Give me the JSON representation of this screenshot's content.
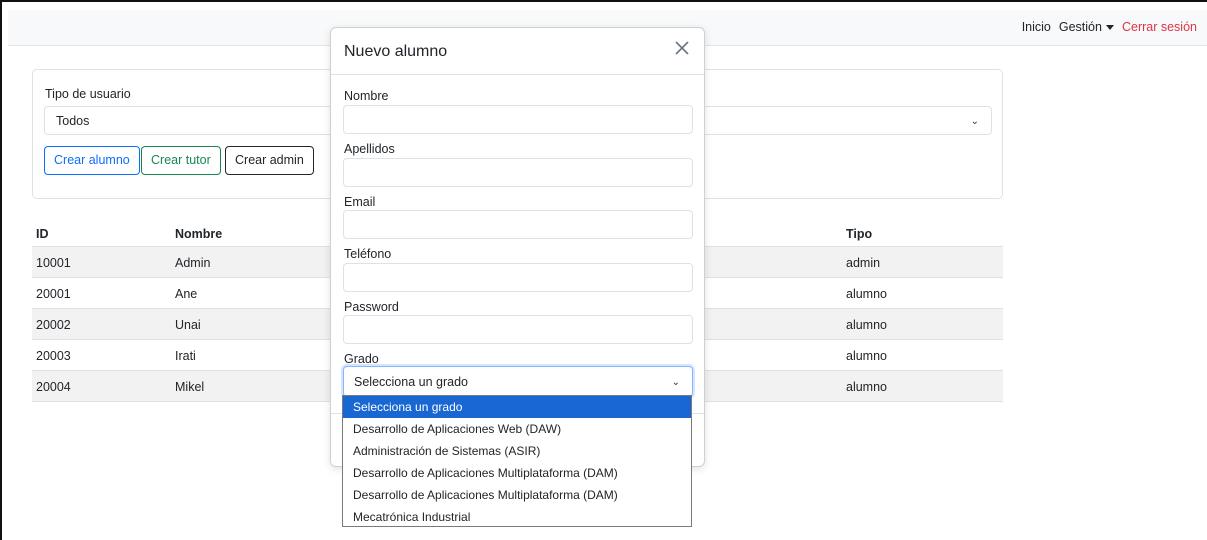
{
  "navbar": {
    "inicio": "Inicio",
    "gestion": "Gestión",
    "cerrar_sesion": "Cerrar sesión"
  },
  "filter": {
    "label": "Tipo de usuario",
    "value": "Todos",
    "buttons": {
      "crear_alumno": "Crear alumno",
      "crear_tutor": "Crear tutor",
      "crear_admin": "Crear admin"
    }
  },
  "table": {
    "headers": {
      "id": "ID",
      "nombre": "Nombre",
      "tipo": "Tipo"
    },
    "rows": [
      {
        "id": "10001",
        "nombre": "Admin",
        "tipo": "admin"
      },
      {
        "id": "20001",
        "nombre": "Ane",
        "tipo": "alumno"
      },
      {
        "id": "20002",
        "nombre": "Unai",
        "tipo": "alumno"
      },
      {
        "id": "20003",
        "nombre": "Irati",
        "tipo": "alumno"
      },
      {
        "id": "20004",
        "nombre": "Mikel",
        "tipo": "alumno"
      }
    ]
  },
  "modal": {
    "title": "Nuevo alumno",
    "fields": {
      "nombre": {
        "label": "Nombre",
        "value": ""
      },
      "apellidos": {
        "label": "Apellidos",
        "value": ""
      },
      "email": {
        "label": "Email",
        "value": ""
      },
      "telefono": {
        "label": "Teléfono",
        "value": ""
      },
      "password": {
        "label": "Password",
        "value": ""
      },
      "grado": {
        "label": "Grado",
        "value": "Selecciona un grado"
      }
    },
    "grado_options": [
      "Selecciona un grado",
      "Desarrollo de Aplicaciones Web (DAW)",
      "Administración de Sistemas (ASIR)",
      "Desarrollo de Aplicaciones Multiplataforma (DAM)",
      "Desarrollo de Aplicaciones Multiplataforma (DAM)",
      "Mecatrónica Industrial"
    ],
    "selected_option_index": 0
  },
  "colors": {
    "primary": "#0d6efd",
    "success": "#198754",
    "danger": "#dc3545",
    "selected_option_bg": "#1967d2"
  }
}
